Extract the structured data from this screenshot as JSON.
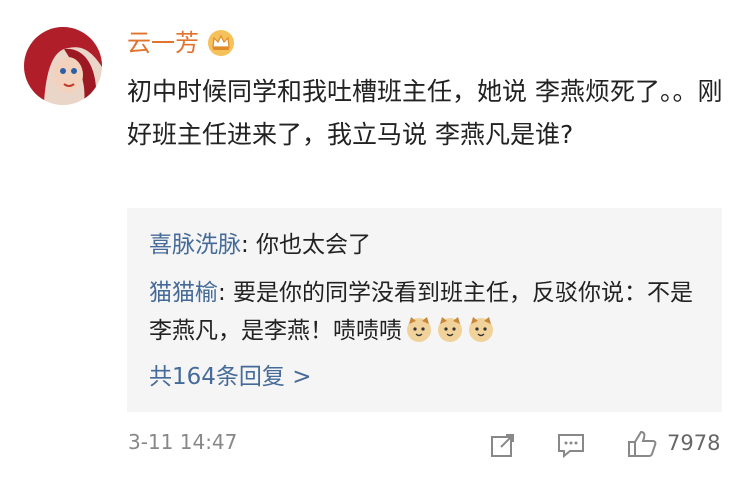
{
  "user": {
    "name": "云一芳",
    "badge_icon": "crown-badge-icon"
  },
  "comment": {
    "text": "初中时候同学和我吐槽班主任，她说 李燕烦死了。。刚好班主任进来了，我立马说 李燕凡是谁?"
  },
  "replies": [
    {
      "author": "喜脉洗脉",
      "text": ": 你也太会了"
    },
    {
      "author": "猫猫榆",
      "text": ": 要是你的同学没看到班主任，反驳你说：不是李燕凡，是李燕！啧啧啧"
    }
  ],
  "more_replies": "共164条回复 >",
  "meta": {
    "timestamp": "3-11 14:47",
    "like_count": "7978"
  },
  "colors": {
    "username": "#e0742f",
    "link": "#466b99",
    "reply_bg": "#f5f5f5"
  }
}
